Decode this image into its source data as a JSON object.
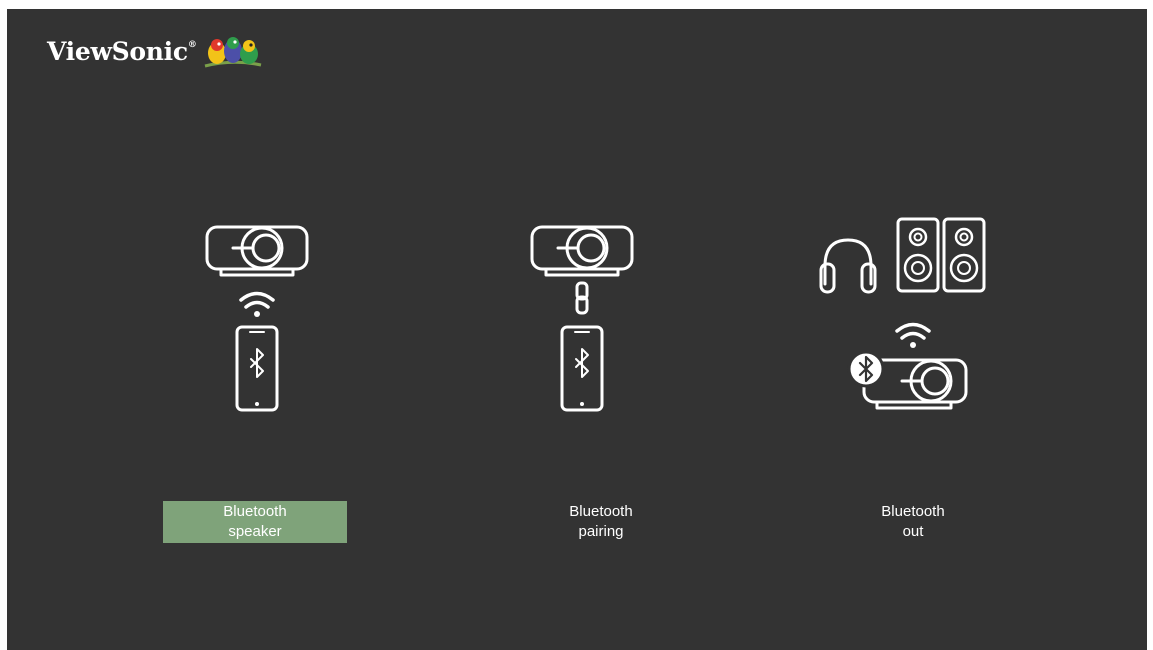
{
  "brand": {
    "name": "ViewSonic",
    "logo_icon": "birds-logo-icon"
  },
  "colors": {
    "background": "#333333",
    "accent": "#7fa37a",
    "text": "#ffffff"
  },
  "options": [
    {
      "line1": "Bluetooth",
      "line2": "speaker",
      "selected": true,
      "icon": "projector-to-phone-bluetooth-icon"
    },
    {
      "line1": "Bluetooth",
      "line2": "pairing",
      "selected": false,
      "icon": "projector-phone-link-icon"
    },
    {
      "line1": "Bluetooth",
      "line2": "out",
      "selected": false,
      "icon": "projector-to-headphones-speakers-icon"
    }
  ]
}
